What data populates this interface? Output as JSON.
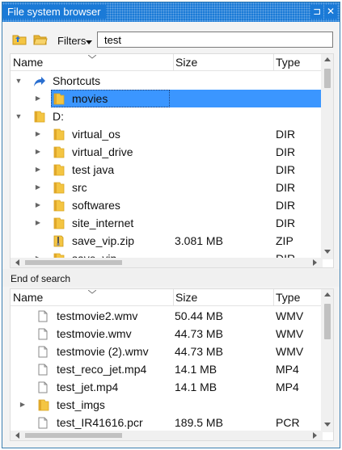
{
  "window": {
    "title": "File system browser",
    "pin_glyph": "⊐",
    "close_glyph": "✕"
  },
  "toolbar": {
    "filters_label": "Filters",
    "search_value": "test"
  },
  "tree": {
    "columns": {
      "name": "Name",
      "size": "Size",
      "type": "Type"
    },
    "rows": [
      {
        "name": "Shortcuts",
        "size": "",
        "type": "",
        "level": 0,
        "expander": "expanded",
        "icon": "shortcut-icon",
        "selected": false
      },
      {
        "name": "movies",
        "size": "",
        "type": "",
        "level": 1,
        "expander": "collapsed",
        "icon": "folder-icon",
        "selected": true
      },
      {
        "name": "D:",
        "size": "",
        "type": "",
        "level": 0,
        "expander": "expanded",
        "icon": "folder-icon",
        "selected": false
      },
      {
        "name": "virtual_os",
        "size": "",
        "type": "DIR",
        "level": 1,
        "expander": "collapsed",
        "icon": "folder-icon",
        "selected": false
      },
      {
        "name": "virtual_drive",
        "size": "",
        "type": "DIR",
        "level": 1,
        "expander": "collapsed",
        "icon": "folder-icon",
        "selected": false
      },
      {
        "name": "test java",
        "size": "",
        "type": "DIR",
        "level": 1,
        "expander": "collapsed",
        "icon": "folder-icon",
        "selected": false
      },
      {
        "name": "src",
        "size": "",
        "type": "DIR",
        "level": 1,
        "expander": "collapsed",
        "icon": "folder-icon",
        "selected": false
      },
      {
        "name": "softwares",
        "size": "",
        "type": "DIR",
        "level": 1,
        "expander": "collapsed",
        "icon": "folder-icon",
        "selected": false
      },
      {
        "name": "site_internet",
        "size": "",
        "type": "DIR",
        "level": 1,
        "expander": "collapsed",
        "icon": "folder-icon",
        "selected": false
      },
      {
        "name": "save_vip.zip",
        "size": "3.081 MB",
        "type": "ZIP",
        "level": 1,
        "expander": "none",
        "icon": "zip-icon",
        "selected": false
      },
      {
        "name": "save_vip",
        "size": "",
        "type": "DIR",
        "level": 1,
        "expander": "collapsed",
        "icon": "folder-icon",
        "selected": false
      }
    ]
  },
  "search": {
    "section_label": "End of search",
    "columns": {
      "name": "Name",
      "size": "Size",
      "type": "Type"
    },
    "rows": [
      {
        "name": "testmovie2.wmv",
        "size": "50.44 MB",
        "type": "WMV",
        "expander": "none",
        "icon": "file-icon"
      },
      {
        "name": "testmovie.wmv",
        "size": "44.73 MB",
        "type": "WMV",
        "expander": "none",
        "icon": "file-icon"
      },
      {
        "name": "testmovie (2).wmv",
        "size": "44.73 MB",
        "type": "WMV",
        "expander": "none",
        "icon": "file-icon"
      },
      {
        "name": "test_reco_jet.mp4",
        "size": "14.1 MB",
        "type": "MP4",
        "expander": "none",
        "icon": "file-icon"
      },
      {
        "name": "test_jet.mp4",
        "size": "14.1 MB",
        "type": "MP4",
        "expander": "none",
        "icon": "file-icon"
      },
      {
        "name": "test_imgs",
        "size": "",
        "type": "",
        "expander": "collapsed",
        "icon": "folder-icon"
      },
      {
        "name": "test_IR41616.pcr",
        "size": "189.5 MB",
        "type": "PCR",
        "expander": "none",
        "icon": "file-icon"
      }
    ]
  },
  "colors": {
    "titlebar": "#1a7ad7",
    "selection": "#3b96ff",
    "folder": "#f4c542"
  }
}
